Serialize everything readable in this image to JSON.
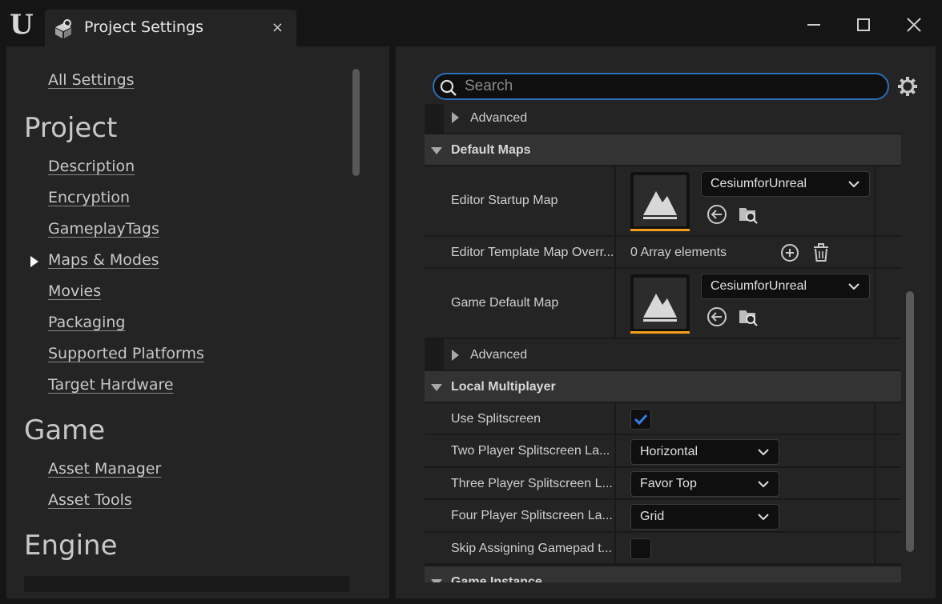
{
  "window": {
    "tab_title": "Project Settings",
    "tab_close": "×"
  },
  "sidebar": {
    "all_settings": "All Settings",
    "sections": [
      {
        "title": "Project",
        "items": [
          "Description",
          "Encryption",
          "GameplayTags",
          "Maps & Modes",
          "Movies",
          "Packaging",
          "Supported Platforms",
          "Target Hardware"
        ]
      },
      {
        "title": "Game",
        "items": [
          "Asset Manager",
          "Asset Tools"
        ]
      },
      {
        "title": "Engine",
        "items": []
      }
    ],
    "selected_item": "Maps & Modes"
  },
  "search": {
    "placeholder": "Search",
    "value": ""
  },
  "details": {
    "advanced_1": "Advanced",
    "default_maps": {
      "title": "Default Maps",
      "editor_startup_map": {
        "label": "Editor Startup Map",
        "value": "CesiumforUnreal"
      },
      "editor_template_map": {
        "label": "Editor Template Map Overr...",
        "value": "0 Array elements"
      },
      "game_default_map": {
        "label": "Game Default Map",
        "value": "CesiumforUnreal"
      },
      "advanced": "Advanced"
    },
    "local_multiplayer": {
      "title": "Local Multiplayer",
      "use_splitscreen": {
        "label": "Use Splitscreen",
        "checked": true
      },
      "two_player": {
        "label": "Two Player Splitscreen La...",
        "value": "Horizontal"
      },
      "three_player": {
        "label": "Three Player Splitscreen L...",
        "value": "Favor Top"
      },
      "four_player": {
        "label": "Four Player Splitscreen La...",
        "value": "Grid"
      },
      "skip_gamepad": {
        "label": "Skip Assigning Gamepad t...",
        "checked": false
      }
    },
    "game_instance": {
      "title": "Game Instance"
    }
  },
  "colors": {
    "accent_blue": "#2e6db8",
    "thumbnail_accent": "#f59e1b",
    "check_blue": "#2f80ed"
  }
}
